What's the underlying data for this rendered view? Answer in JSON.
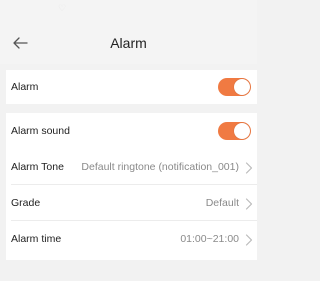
{
  "header": {
    "title": "Alarm",
    "back_icon": "arrow-left-icon"
  },
  "alarm_card": {
    "label": "Alarm",
    "enabled": true
  },
  "settings": {
    "alarm_sound": {
      "label": "Alarm sound",
      "enabled": true
    },
    "alarm_tone": {
      "label": "Alarm Tone",
      "value": "Default ringtone (notification_001)"
    },
    "grade": {
      "label": "Grade",
      "value": "Default"
    },
    "alarm_time": {
      "label": "Alarm time",
      "value": "01:00~21:00"
    }
  },
  "colors": {
    "toggle_on": "#f07a42",
    "background": "#f2f2f2",
    "card": "#ffffff"
  }
}
